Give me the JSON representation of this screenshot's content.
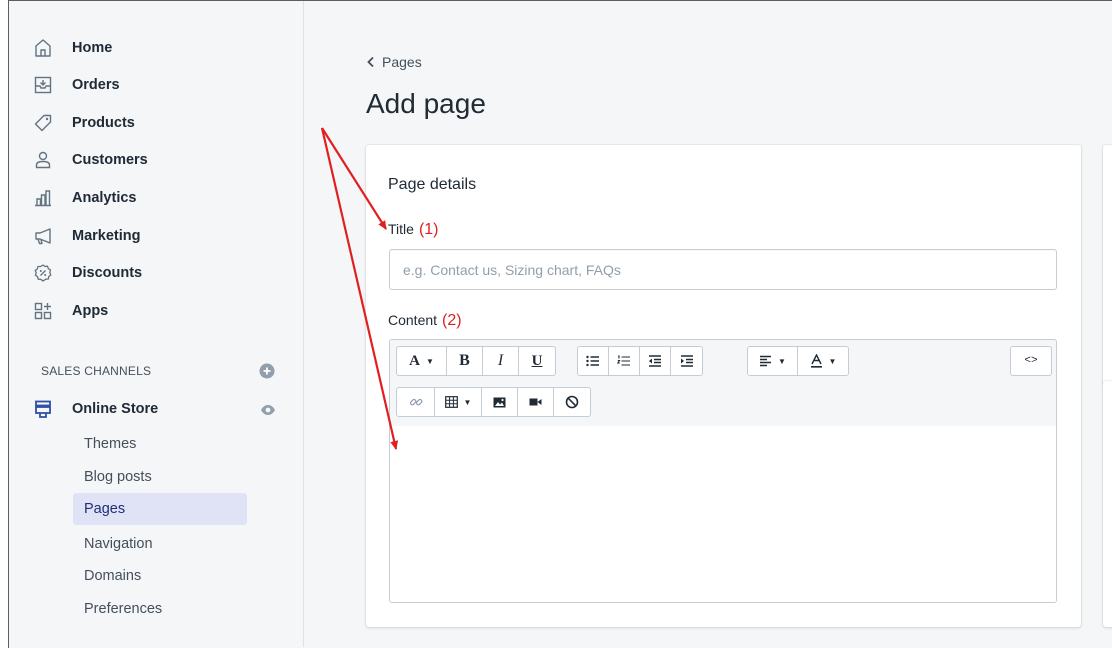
{
  "sidebar": {
    "items": [
      {
        "label": "Home",
        "icon": "home-icon"
      },
      {
        "label": "Orders",
        "icon": "orders-icon"
      },
      {
        "label": "Products",
        "icon": "tag-icon"
      },
      {
        "label": "Customers",
        "icon": "person-icon"
      },
      {
        "label": "Analytics",
        "icon": "bar-chart-icon"
      },
      {
        "label": "Marketing",
        "icon": "megaphone-icon"
      },
      {
        "label": "Discounts",
        "icon": "discount-icon"
      },
      {
        "label": "Apps",
        "icon": "apps-icon"
      }
    ],
    "channels_header": "SALES CHANNELS",
    "online_store": "Online Store",
    "sub_items": [
      {
        "label": "Themes",
        "active": false
      },
      {
        "label": "Blog posts",
        "active": false
      },
      {
        "label": "Pages",
        "active": true
      },
      {
        "label": "Navigation",
        "active": false
      },
      {
        "label": "Domains",
        "active": false
      },
      {
        "label": "Preferences",
        "active": false
      }
    ]
  },
  "main": {
    "breadcrumb": "Pages",
    "title": "Add page",
    "card": {
      "heading": "Page details",
      "title_label": "Title",
      "title_annotation": "(1)",
      "title_placeholder": "e.g. Contact us, Sizing chart, FAQs",
      "title_value": "",
      "content_label": "Content",
      "content_annotation": "(2)"
    },
    "toolbar": {
      "font_button": "A",
      "bold": "B",
      "italic": "I",
      "underline": "U",
      "html_button": "<>"
    }
  },
  "colors": {
    "sidebar_bg": "#f4f6f8",
    "active_item_bg": "#dfe3f5",
    "annotation": "#e02020",
    "arrow": "#e02020"
  }
}
